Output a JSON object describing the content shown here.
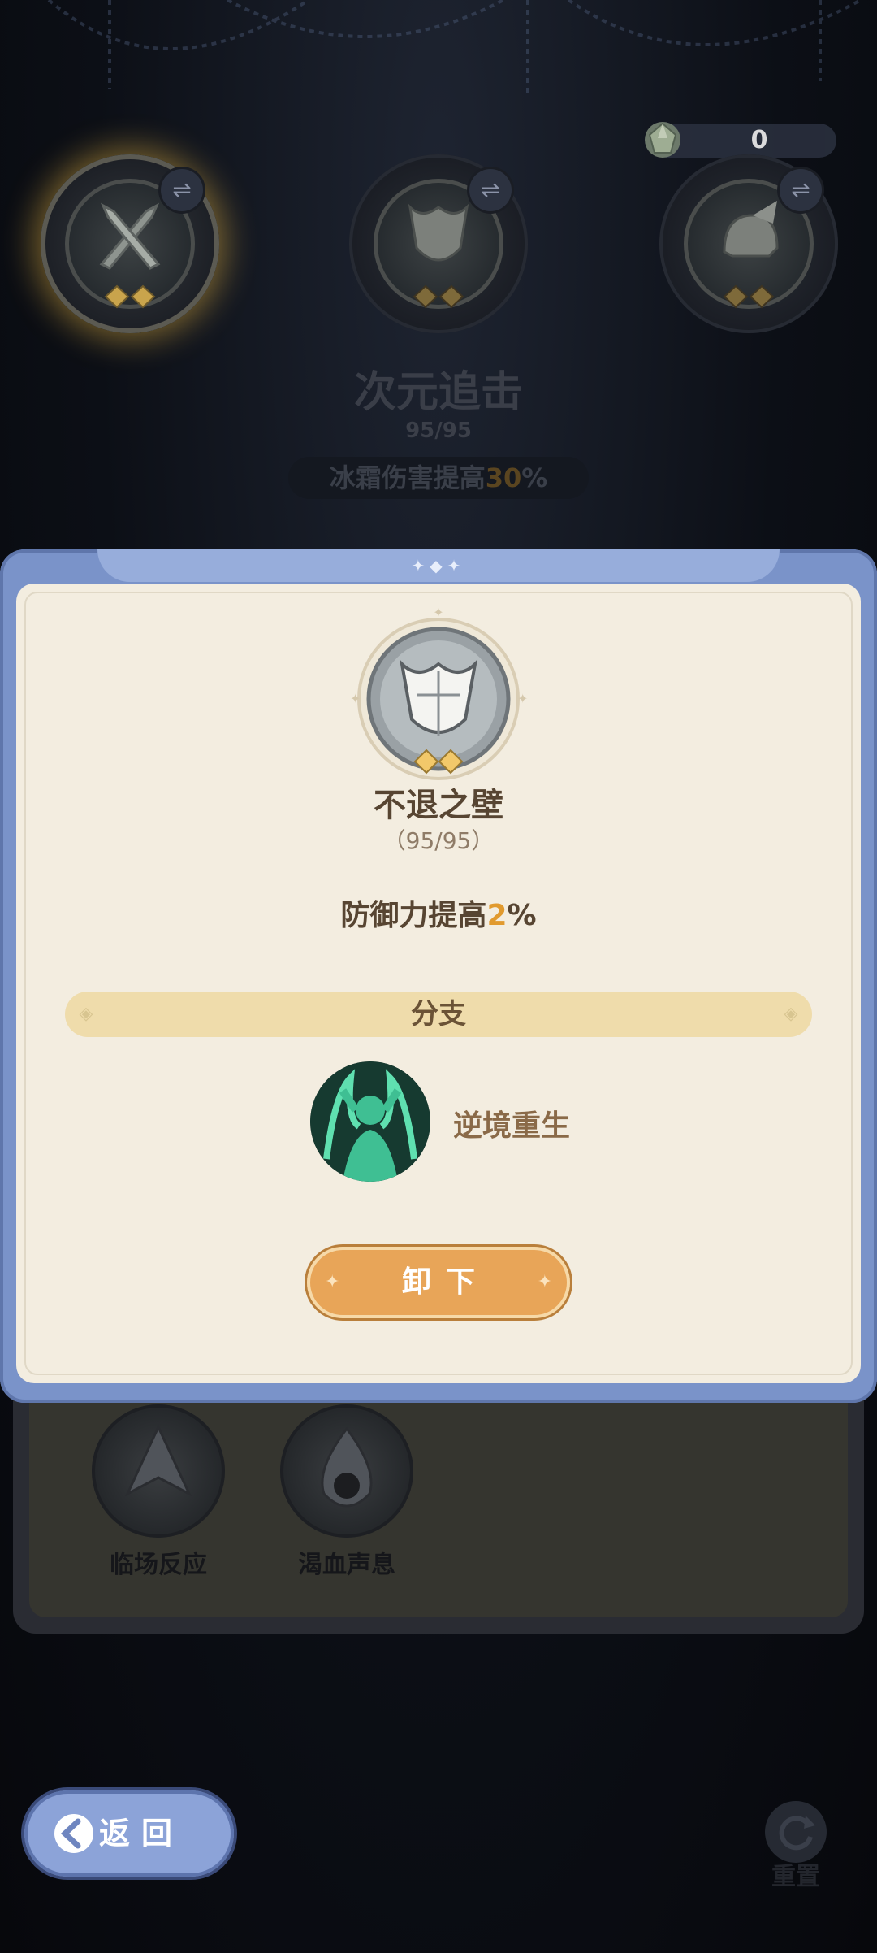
{
  "currency": {
    "icon": "crystal-gem-icon",
    "value": "0"
  },
  "top_slots": [
    {
      "icon": "crossed-swords-icon",
      "active": true
    },
    {
      "icon": "tulip-shield-icon",
      "active": false
    },
    {
      "icon": "winged-helmet-icon",
      "active": false
    }
  ],
  "selected_skill": {
    "title": "次元追击",
    "count": "95/95",
    "effect_prefix": "冰霜伤害提高",
    "effect_value": "30",
    "effect_suffix": "%"
  },
  "dialog": {
    "emblem_icon": "tulip-shield-icon",
    "title": "不退之壁",
    "count": "（95/95）",
    "effect_prefix": "防御力提高",
    "effect_value": "2",
    "effect_suffix": "%",
    "branch_header": "分支",
    "branch_item": {
      "icon": "rebirth-figure-icon",
      "label": "逆境重生"
    },
    "unequip_label": "卸下"
  },
  "background_branches": [
    {
      "icon": "crystal-arrow-icon",
      "label": "临场反应"
    },
    {
      "icon": "blood-drop-skull-icon",
      "label": "渴血声息"
    }
  ],
  "footer": {
    "back_label": "返回",
    "reset_label": "重置"
  },
  "colors": {
    "dialog_frame": "#7a93c9",
    "paper": "#f3ede0",
    "accent_orange": "#e19a2e",
    "button_orange": "#e8a558"
  }
}
